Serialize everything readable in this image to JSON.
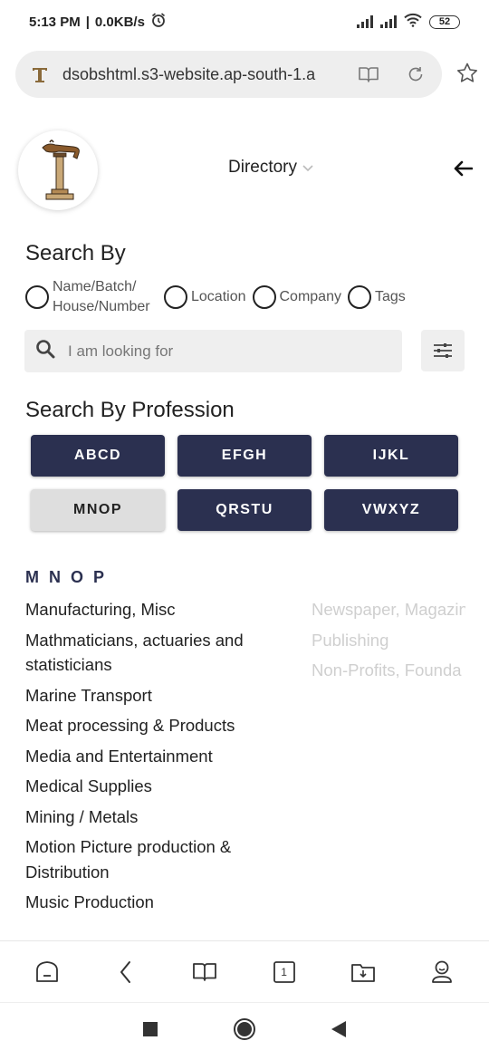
{
  "status_bar": {
    "time": "5:13 PM",
    "separator": "|",
    "speed": "0.0KB/s",
    "battery": "52"
  },
  "browser": {
    "url": "dsobshtml.s3-website.ap-south-1.a",
    "favicon_icon": "lamp-logo-icon"
  },
  "header": {
    "menu_label": "Directory",
    "logo_icon": "oil-lamp-logo"
  },
  "search": {
    "title": "Search By",
    "options": [
      {
        "label": "Name/Batch/ House/Number"
      },
      {
        "label": "Location"
      },
      {
        "label": "Company"
      },
      {
        "label": "Tags"
      }
    ],
    "placeholder": "I am looking for"
  },
  "profession": {
    "title": "Search By Profession",
    "buttons": [
      {
        "label": "ABCD",
        "active": false
      },
      {
        "label": "EFGH",
        "active": false
      },
      {
        "label": "IJKL",
        "active": false
      },
      {
        "label": "MNOP",
        "active": true
      },
      {
        "label": "QRSTU",
        "active": false
      },
      {
        "label": "VWXYZ",
        "active": false
      }
    ],
    "letters": "MNOP",
    "items": [
      "Manufacturing, Misc",
      "Mathmaticians, actuaries and statisticians",
      "Marine Transport",
      "Meat processing & Products",
      "Media and Entertainment",
      "Medical Supplies",
      "Mining / Metals",
      "Motion Picture production & Distribution",
      "Music Production"
    ],
    "items_right": [
      "Newspaper, Magazin",
      "Publishing",
      "Non-Profits, Founda"
    ]
  },
  "bottom_nav": {
    "tab_count": "1"
  },
  "colors": {
    "button_dark": "#2b3050",
    "button_active": "#dedede",
    "search_bg": "#efefef"
  }
}
